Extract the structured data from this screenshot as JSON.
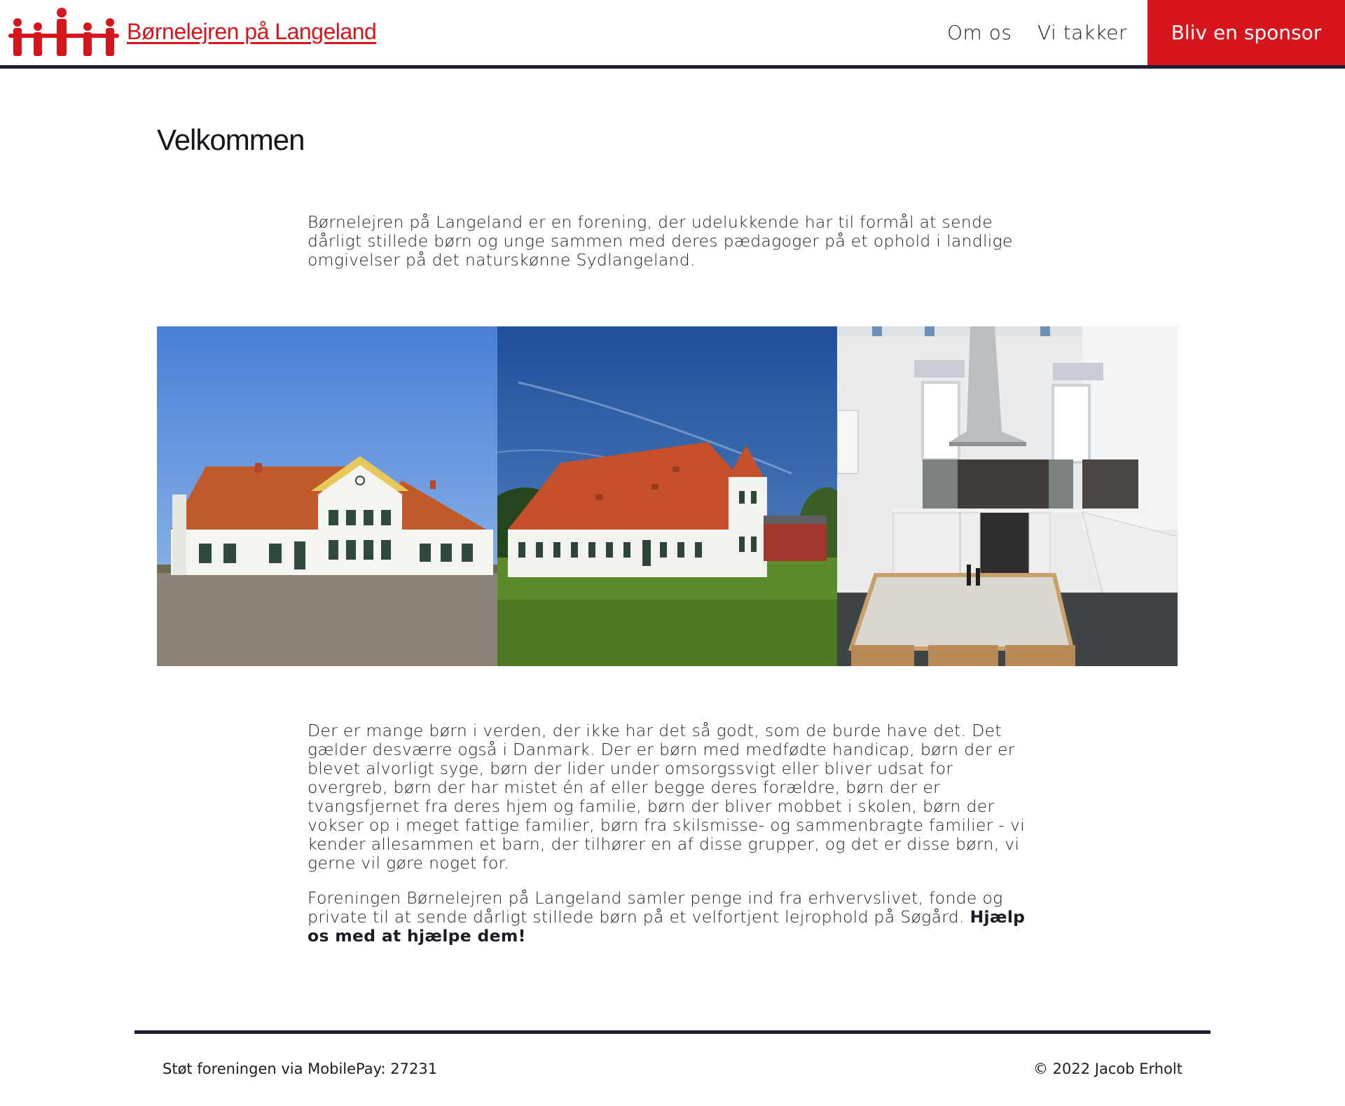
{
  "header": {
    "brand": "Børnelejren på Langeland",
    "nav": [
      {
        "label": "Om os"
      },
      {
        "label": "Vi takker"
      }
    ],
    "cta": "Bliv en sponsor"
  },
  "main": {
    "title": "Velkommen",
    "intro": "Børnelejren på Langeland er en forening, der udelukkende har til formål at sende dårligt stillede børn og unge sammen med deres pædagoger på et ophold i landlige omgivelser på det naturskønne Sydlangeland.",
    "paragraph1": "Der er mange børn i verden, der ikke har det så godt, som de burde have det. Det gælder desværre også i Danmark. Der er børn med medfødte handicap, børn der er blevet alvorligt syge, børn der lider under omsorgssvigt eller bliver udsat for overgreb, børn der har mistet én af eller begge deres forældre, børn der er tvangsfjernet fra deres hjem og familie, børn der bliver mobbet i skolen, børn der vokser op i meget fattige familier, børn fra skilsmisse- og sammenbragte familier - vi kender allesammen et barn, der tilhører en af disse grupper, og det er disse børn, vi gerne vil gøre noget for.",
    "paragraph2": "Foreningen Børnelejren på Langeland samler penge ind fra erhvervslivet, fonde og private til at sende dårligt stillede børn på et velfortjent lejrophold på Søgård.",
    "paragraph2_bold": "Hjælp os med at hjælpe dem!"
  },
  "footer": {
    "left": "Støt foreningen via MobilePay: 27231",
    "right": "© 2022 Jacob Erholt"
  },
  "colors": {
    "accent": "#d6151d",
    "rule": "#1d1d33"
  }
}
